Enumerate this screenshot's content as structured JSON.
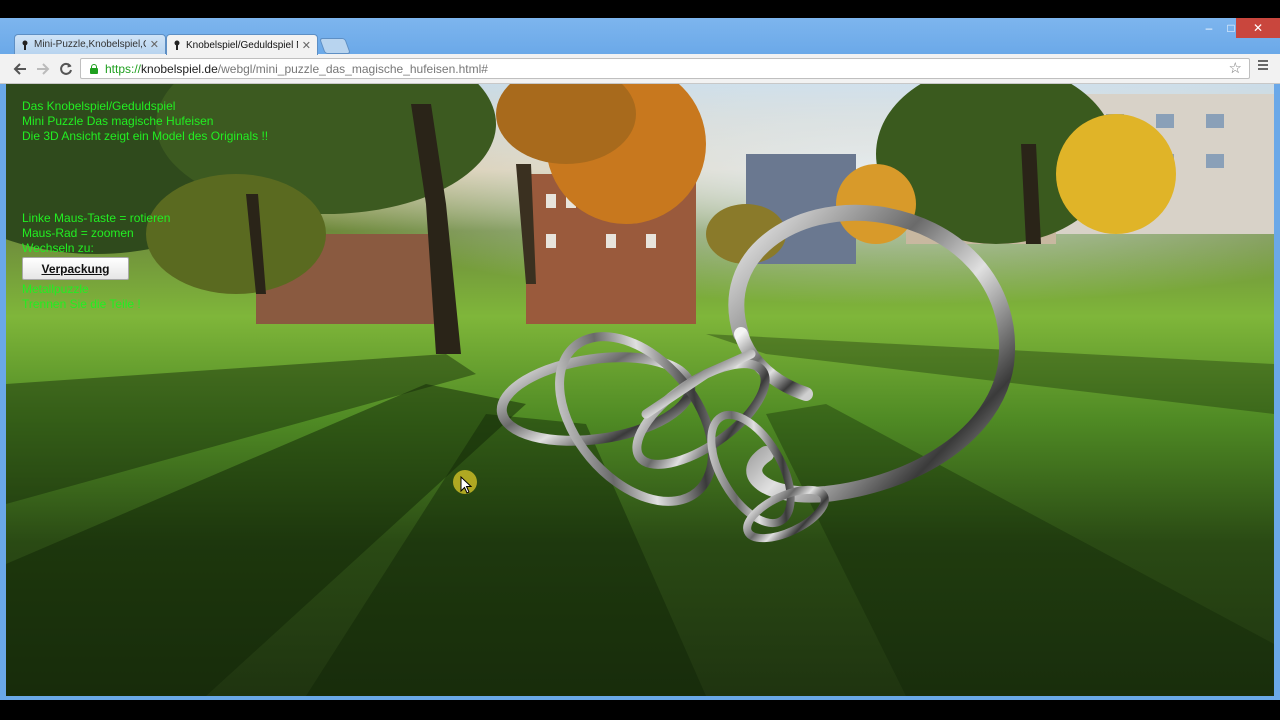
{
  "browser": {
    "tabs": [
      {
        "title": "Mini-Puzzle,Knobelspiel,G",
        "active": false
      },
      {
        "title": "Knobelspiel/Geduldspiel M",
        "active": true
      }
    ],
    "url": {
      "scheme": "https://",
      "host": "knobelspiel.de",
      "path": "/webgl/mini_puzzle_das_magische_hufeisen.html#"
    },
    "window_controls": {
      "minimize": "–",
      "maximize": "□",
      "close": "✕"
    }
  },
  "overlay": {
    "heading_lines": [
      "Das Knobelspiel/Geduldspiel",
      "Mini Puzzle Das magische Hufeisen",
      "Die 3D Ansicht zeigt ein Model des Originals !!"
    ],
    "controls_lines": [
      "Linke Maus-Taste = rotieren",
      "Maus-Rad = zoomen",
      "Wechseln zu:"
    ],
    "switch_button_label": "Verpackung",
    "footer_lines": [
      "Metallpuzzle",
      "Trennen Sie die Teile !"
    ]
  },
  "colors": {
    "overlay_text": "#22ee22",
    "tab_strip": "#6aa8e8",
    "secure_green": "#1e9f1e"
  },
  "icons": [
    "back-arrow-icon",
    "forward-arrow-icon",
    "reload-icon",
    "lock-icon",
    "bookmark-star-icon",
    "chrome-menu-icon",
    "tab-favicon",
    "tab-close-icon"
  ]
}
